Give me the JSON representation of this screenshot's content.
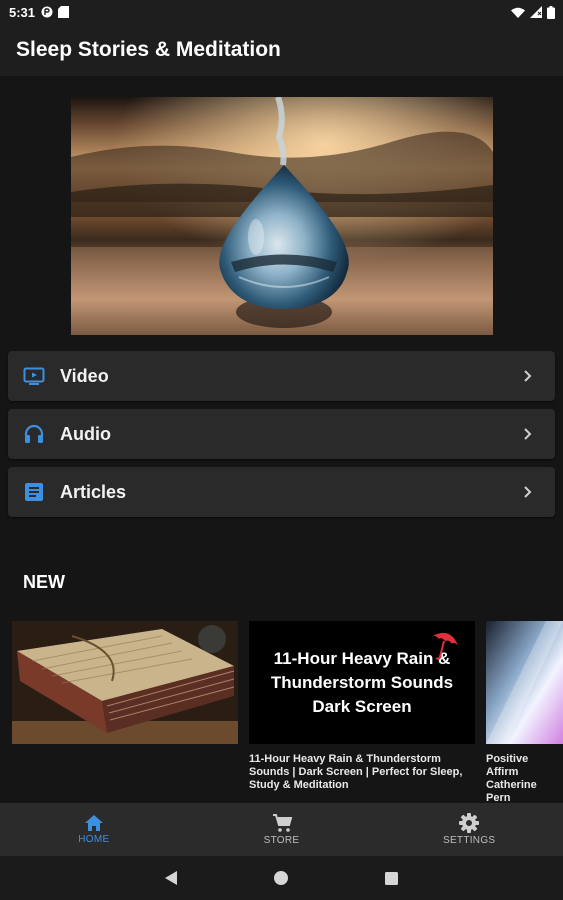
{
  "status_bar": {
    "time": "5:31",
    "icons": [
      "app-notification-icon",
      "app-notification-icon",
      "wifi-icon",
      "signal-icon",
      "battery-icon"
    ]
  },
  "app_bar": {
    "title": "Sleep Stories & Meditation"
  },
  "menu": [
    {
      "label": "Video",
      "icon": "tv-icon"
    },
    {
      "label": "Audio",
      "icon": "headphones-icon"
    },
    {
      "label": "Articles",
      "icon": "article-icon"
    }
  ],
  "new_section": {
    "title": "NEW",
    "cards": [
      {
        "caption": "",
        "thumb_text": ""
      },
      {
        "caption": "11-Hour Heavy Rain & Thunderstorm Sounds | Dark Screen | Perfect for Sleep, Study & Meditation",
        "thumb_text": "11-Hour Heavy Rain & Thunderstorm Sounds Dark Screen"
      },
      {
        "caption": "Positive Affirm Catherine Pern",
        "thumb_text": ""
      }
    ]
  },
  "bottom_nav": [
    {
      "label": "HOME",
      "icon": "home-icon",
      "active": true
    },
    {
      "label": "STORE",
      "icon": "cart-icon",
      "active": false
    },
    {
      "label": "SETTINGS",
      "icon": "gear-icon",
      "active": false
    }
  ],
  "colors": {
    "accent": "#3d8fe0",
    "background": "#151515",
    "card": "#2a2a2a"
  }
}
